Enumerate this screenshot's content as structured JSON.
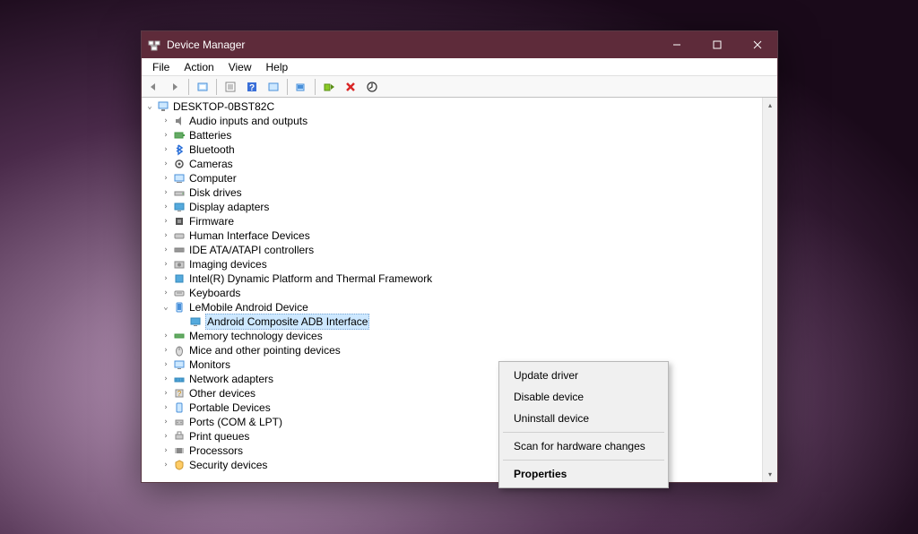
{
  "window": {
    "title": "Device Manager"
  },
  "menus": {
    "file": "File",
    "action": "Action",
    "view": "View",
    "help": "Help"
  },
  "tree": {
    "root": "DESKTOP-0BST82C",
    "nodes": [
      "Audio inputs and outputs",
      "Batteries",
      "Bluetooth",
      "Cameras",
      "Computer",
      "Disk drives",
      "Display adapters",
      "Firmware",
      "Human Interface Devices",
      "IDE ATA/ATAPI controllers",
      "Imaging devices",
      "Intel(R) Dynamic Platform and Thermal Framework",
      "Keyboards",
      "LeMobile Android Device",
      "Memory technology devices",
      "Mice and other pointing devices",
      "Monitors",
      "Network adapters",
      "Other devices",
      "Portable Devices",
      "Ports (COM & LPT)",
      "Print queues",
      "Processors",
      "Security devices"
    ],
    "child": "Android Composite ADB Interface"
  },
  "context_menu": {
    "update": "Update driver",
    "disable": "Disable device",
    "uninstall": "Uninstall device",
    "scan": "Scan for hardware changes",
    "properties": "Properties"
  }
}
